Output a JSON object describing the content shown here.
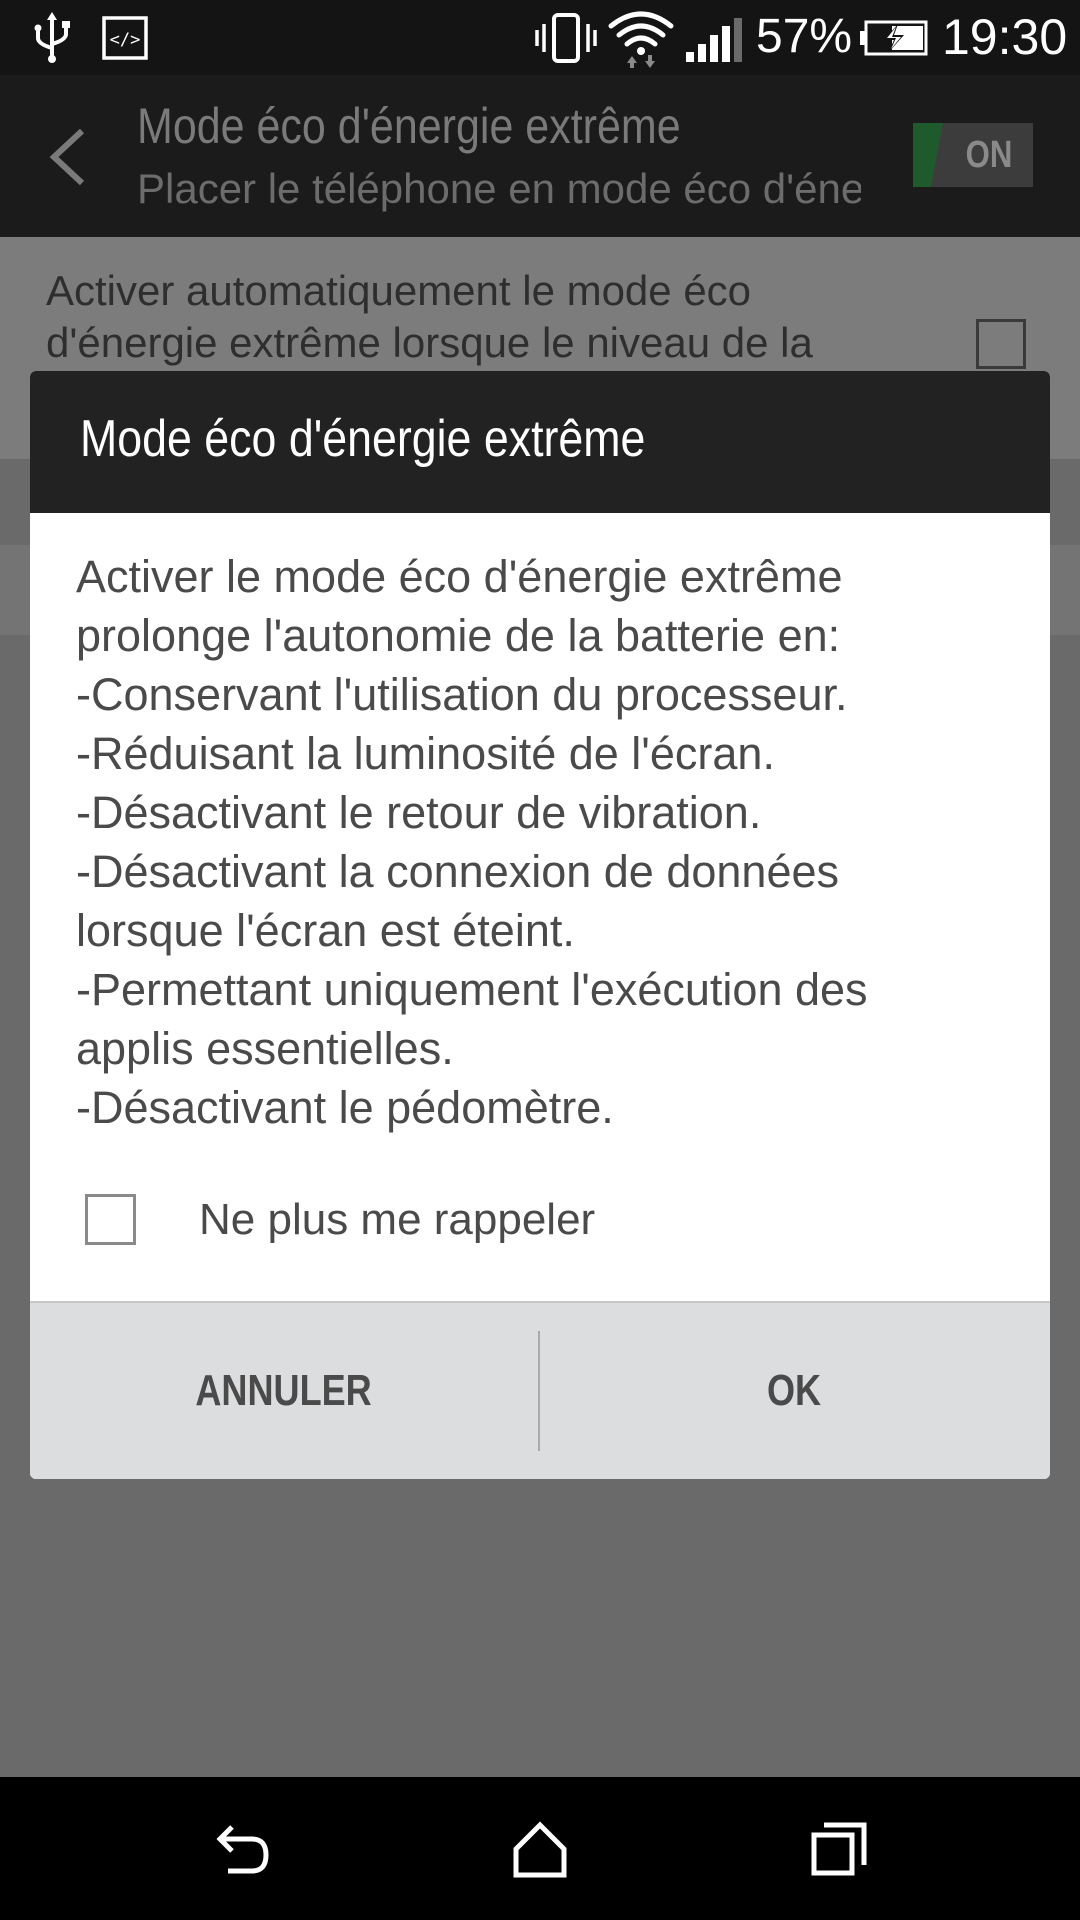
{
  "status_bar": {
    "battery_percent": "57%",
    "time": "19:30",
    "icons": [
      "usb-icon",
      "developer-icon",
      "vibrate-icon",
      "wifi-icon",
      "signal-icon",
      "battery-charging-icon"
    ]
  },
  "action_bar": {
    "title": "Mode éco d'énergie extrême",
    "subtitle": "Placer le téléphone en mode éco d'énergie extrême",
    "toggle_label": "ON",
    "toggle_state": "on"
  },
  "settings": {
    "auto_activate_text": "Activer automatiquement le mode éco d'énergie extrême lorsque le niveau de la"
  },
  "dialog": {
    "title": "Mode éco d'énergie extrême",
    "body_lines": [
      "Activer le mode éco d'énergie extrême",
      "prolonge l'autonomie de la batterie en:",
      "-Conservant l'utilisation du processeur.",
      "-Réduisant la luminosité de l'écran.",
      "-Désactivant le retour de vibration.",
      "-Désactivant la connexion de données",
      "lorsque l'écran est éteint.",
      "-Permettant uniquement l'exécution des",
      "applis essentielles.",
      "-Désactivant le pédomètre."
    ],
    "remind_label": "Ne plus me rappeler",
    "cancel_label": "ANNULER",
    "ok_label": "OK"
  },
  "colors": {
    "toggle_accent": "#1e5a2c",
    "dialog_header": "#222222",
    "footer": "#dcdddf"
  }
}
